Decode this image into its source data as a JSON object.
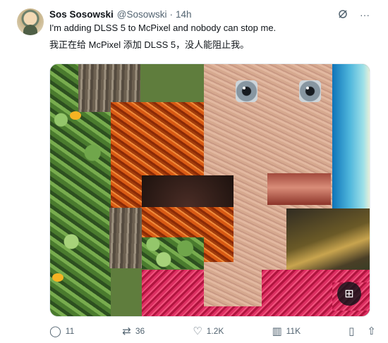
{
  "author": {
    "display_name": "Sos Sosowski",
    "handle": "@Sosowski",
    "separator": "·",
    "time": "14h"
  },
  "post": {
    "line1": "I'm adding DLSS 5 to McPixel and nobody can stop me.",
    "line2": "我正在给 McPixel 添加 DLSS 5，没人能阻止我。"
  },
  "actions": {
    "reply_count": "11",
    "repost_count": "36",
    "like_count": "1.2K",
    "view_count": "11K"
  },
  "icons": {
    "grok": "grok-icon",
    "more": "more-icon",
    "reply": "reply-icon",
    "repost": "repost-icon",
    "like": "heart-icon",
    "views": "views-icon",
    "bookmark": "bookmark-icon",
    "share": "share-icon"
  },
  "colors": {
    "text": "#0f1419",
    "secondary": "#536471"
  }
}
